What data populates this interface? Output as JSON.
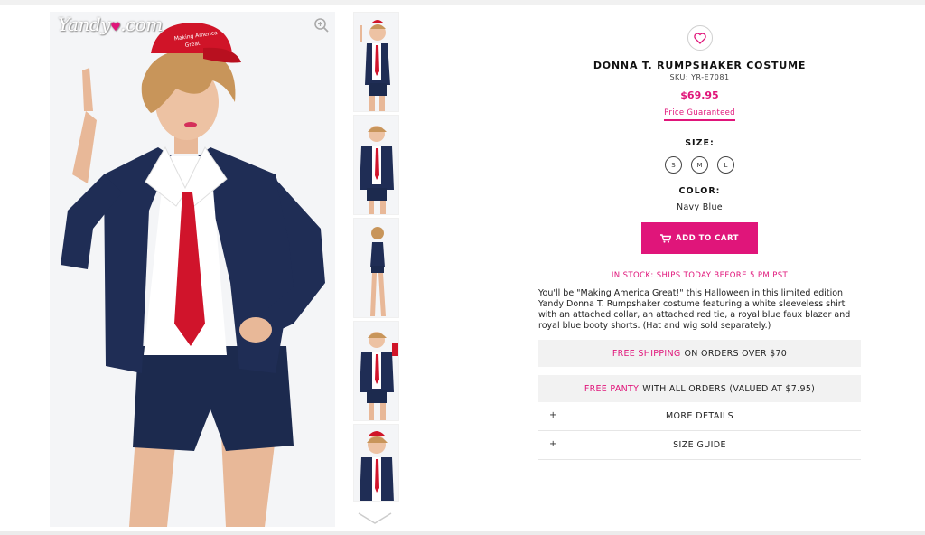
{
  "brand": {
    "logo_text": "Yandy",
    "logo_suffix": ".com"
  },
  "product": {
    "title": "DONNA T. RUMPSHAKER COSTUME",
    "sku": "SKU: YR-E7081",
    "price": "$69.95",
    "price_guarantee": "Price Guaranteed",
    "size_label": "SIZE:",
    "sizes": [
      "S",
      "M",
      "L"
    ],
    "color_label": "COLOR:",
    "color_value": "Navy Blue",
    "add_to_cart": "ADD TO CART",
    "stock_status": "IN STOCK: SHIPS TODAY BEFORE 5 PM PST",
    "description": "You'll be \"Making America Great!\" this Halloween in this limited edition Yandy Donna T. Rumpshaker costume featuring a white sleeveless shirt with an attached collar, an attached red tie, a royal blue faux blazer and royal blue booty shorts. (Hat and wig sold separately.)"
  },
  "promos": {
    "shipping_highlight": "FREE SHIPPING",
    "shipping_rest": "ON ORDERS OVER $70",
    "panty_highlight": "FREE PANTY",
    "panty_rest": "WITH ALL ORDERS (VALUED AT $7.95)"
  },
  "accordions": {
    "more_details": "MORE DETAILS",
    "size_guide": "SIZE GUIDE",
    "expand_symbol": "+"
  },
  "images": {
    "hat_text": "Making America Great",
    "thumbnail_count": 5
  },
  "colors": {
    "accent": "#e0157a",
    "navy": "#1c2a4e",
    "tie_red": "#d0142b",
    "promo_bg": "#f2f2f2"
  }
}
